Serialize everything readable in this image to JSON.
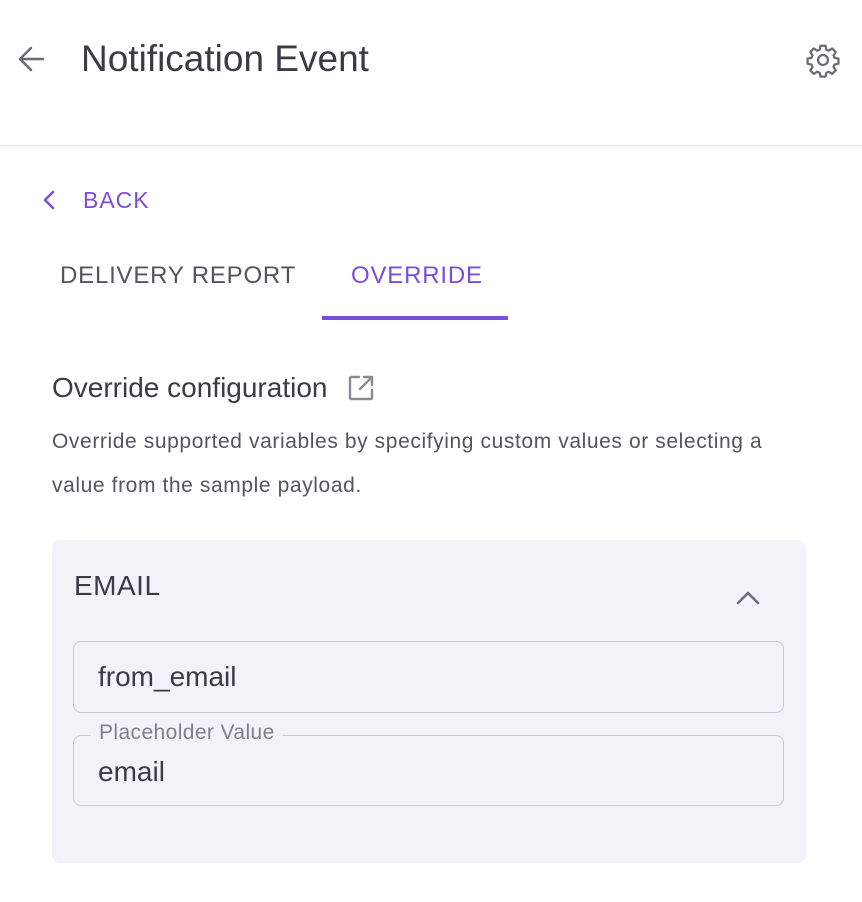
{
  "header": {
    "title": "Notification Event",
    "back_icon": "arrow-left-icon",
    "settings_icon": "gear-icon"
  },
  "nav": {
    "back_label": "BACK",
    "back_icon": "chevron-left-icon"
  },
  "tabs": [
    {
      "label": "DELIVERY REPORT",
      "active": false
    },
    {
      "label": "OVERRIDE",
      "active": true
    }
  ],
  "override": {
    "title": "Override configuration",
    "title_icon": "external-link-icon",
    "description": "Override supported variables by specifying custom values or selecting a value from the sample payload.",
    "card": {
      "title": "EMAIL",
      "collapse_icon": "chevron-up-icon",
      "variable_field": {
        "value": "from_email"
      },
      "placeholder_field": {
        "label": "Placeholder Value",
        "value": "email"
      }
    }
  },
  "colors": {
    "accent": "#7c4ddb",
    "text": "#3b3b45",
    "card_bg": "#f2f3f8",
    "border": "#c8c9d1"
  }
}
